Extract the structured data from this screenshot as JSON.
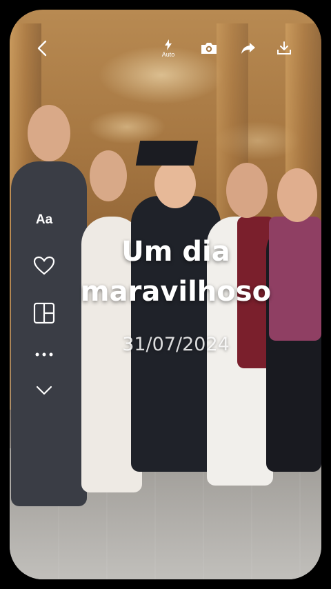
{
  "header": {
    "back_icon": "back-arrow-icon",
    "flash_icon": "flash-auto-icon",
    "flash_label": "Auto",
    "camera_icon": "camera-icon",
    "share_icon": "share-icon",
    "download_icon": "download-icon"
  },
  "sidebar": {
    "text_label": "Aa",
    "icons": [
      "heart-icon",
      "layout-icon",
      "more-icon",
      "chevron-down-icon"
    ]
  },
  "overlay": {
    "title": "Um dia maravilhoso",
    "date": "31/07/2024"
  },
  "colors": {
    "background": "#000000",
    "text": "#ffffff"
  }
}
